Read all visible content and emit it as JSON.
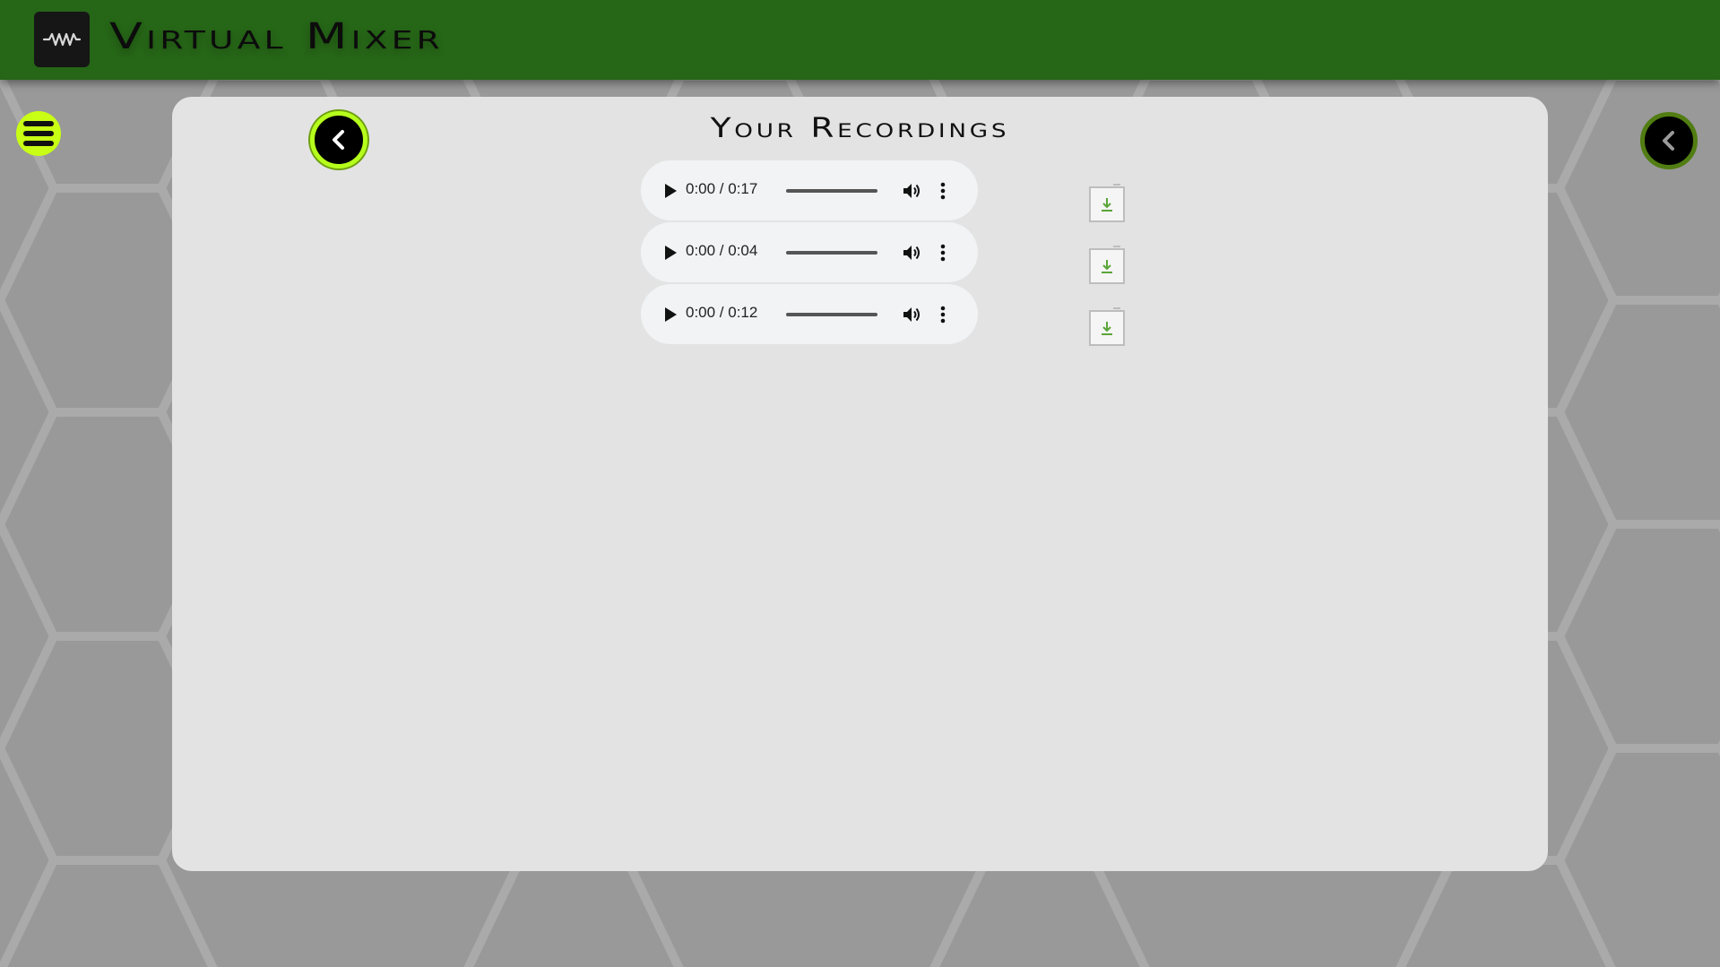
{
  "app": {
    "title": "Virtual Mixer",
    "logo_icon": "waveform-icon"
  },
  "colors": {
    "header": "#266617",
    "accent": "#c8ff14",
    "panel": "#e3e3e3",
    "download_icon": "#5aa53a"
  },
  "nav": {
    "menu_icon": "hamburger-menu-icon",
    "back_icon": "chevron-left-icon"
  },
  "page": {
    "title": "Your Recordings"
  },
  "recordings": [
    {
      "time": "0:00 / 0:17",
      "progress": 0
    },
    {
      "time": "0:00 / 0:04",
      "progress": 0
    },
    {
      "time": "0:00 / 0:12",
      "progress": 0
    }
  ],
  "icons": {
    "play": "play-icon",
    "volume": "volume-icon",
    "more": "more-options-icon",
    "download": "download-icon"
  }
}
